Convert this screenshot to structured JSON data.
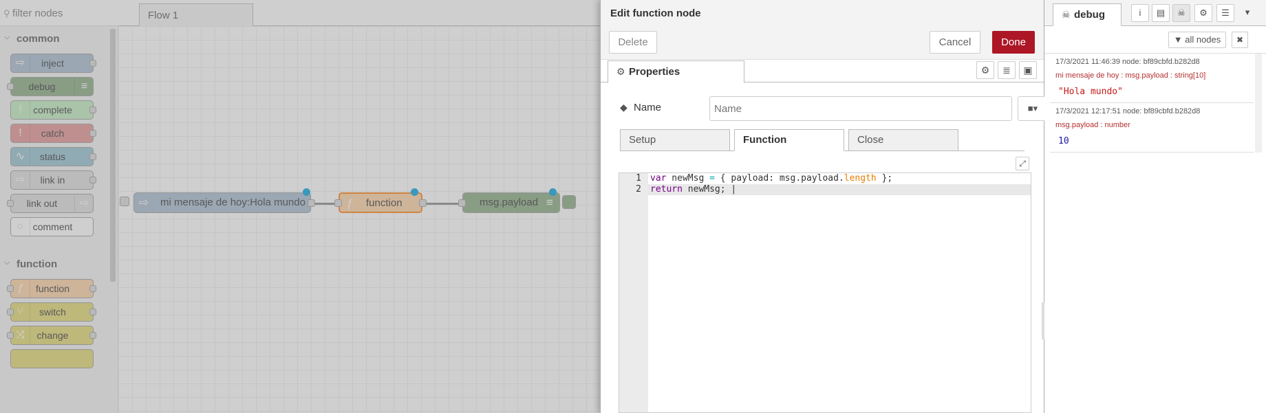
{
  "palette": {
    "search_placeholder": "filter nodes",
    "categories": [
      {
        "name": "common",
        "nodes": [
          "inject",
          "debug",
          "complete",
          "catch",
          "status",
          "link in",
          "link out",
          "comment"
        ]
      },
      {
        "name": "function",
        "nodes": [
          "function",
          "switch",
          "change"
        ]
      }
    ]
  },
  "workspace": {
    "tab": "Flow 1",
    "nodes": [
      {
        "label": "mi mensaje de hoy:Hola mundo",
        "type": "inject"
      },
      {
        "label": "function",
        "type": "function"
      },
      {
        "label": "msg.payload",
        "type": "debug"
      }
    ]
  },
  "tray": {
    "title": "Edit function node",
    "delete_label": "Delete",
    "cancel_label": "Cancel",
    "done_label": "Done",
    "properties_tab": "Properties",
    "name_label": "Name",
    "name_placeholder": "Name",
    "subtabs": [
      "Setup",
      "Function",
      "Close"
    ],
    "active_subtab": "Function",
    "code_lines": [
      "var newMsg = { payload: msg.payload.length };",
      "return newMsg;"
    ]
  },
  "sidebar": {
    "tab_label": "debug",
    "filter_label": "all nodes",
    "messages": [
      {
        "meta": "17/3/2021 11:46:39   node: bf89cbfd.b282d8",
        "topic": "mi mensaje de hoy : msg.payload : string[10]",
        "value": "\"Hola mundo\"",
        "value_color": "#c41a16"
      },
      {
        "meta": "17/3/2021 12:17:51   node: bf89cbfd.b282d8",
        "topic": "msg.payload : number",
        "value": "10",
        "value_color": "#1a1aa6"
      }
    ]
  },
  "colors": {
    "inject": "#a6bbcf",
    "debug": "#87a980",
    "complete": "#c0edc0",
    "catch": "#e49191",
    "status": "#94c1d0",
    "link": "#dddddd",
    "comment": "#ffffff",
    "function": "#fdd0a2",
    "switch": "#e2d96e",
    "change": "#e2d96e",
    "done": "#ad1625",
    "changed_dot": "#00a1e0"
  }
}
